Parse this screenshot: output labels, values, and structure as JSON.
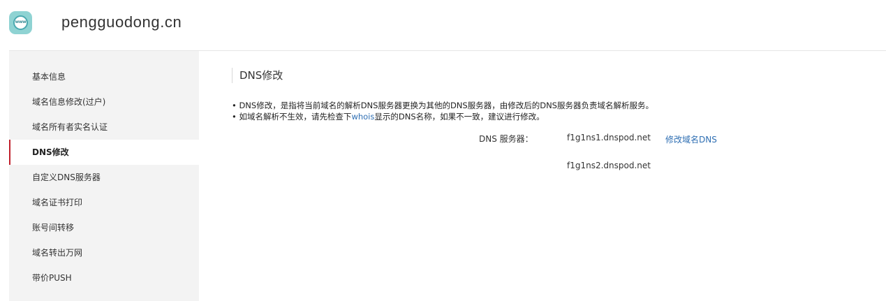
{
  "header": {
    "logo_text": "www",
    "domain": "pengguodong.cn"
  },
  "sidebar": {
    "items": [
      {
        "label": "基本信息",
        "active": false
      },
      {
        "label": "域名信息修改(过户)",
        "active": false
      },
      {
        "label": "域名所有者实名认证",
        "active": false
      },
      {
        "label": "DNS修改",
        "active": true
      },
      {
        "label": "自定义DNS服务器",
        "active": false
      },
      {
        "label": "域名证书打印",
        "active": false
      },
      {
        "label": "账号间转移",
        "active": false
      },
      {
        "label": "域名转出万网",
        "active": false
      },
      {
        "label": "带价PUSH",
        "active": false
      }
    ]
  },
  "main": {
    "title": "DNS修改",
    "note1": "• DNS修改，是指将当前域名的解析DNS服务器更换为其他的DNS服务器，由修改后的DNS服务器负责域名解析服务。",
    "note2_before": "• 如域名解析不生效，请先检查下",
    "note2_link": "whois",
    "note2_after": "显示的DNS名称，如果不一致，建议进行修改。",
    "dns_label": "DNS 服务器：",
    "dns_servers": [
      "f1g1ns1.dnspod.net",
      "f1g1ns2.dnspod.net"
    ],
    "modify_link": "修改域名DNS"
  },
  "colors": {
    "active_accent": "#c0202c",
    "link": "#2f6fb3",
    "sidebar_bg": "#f3f3f3",
    "logo_bg": "#8fd3d3"
  }
}
